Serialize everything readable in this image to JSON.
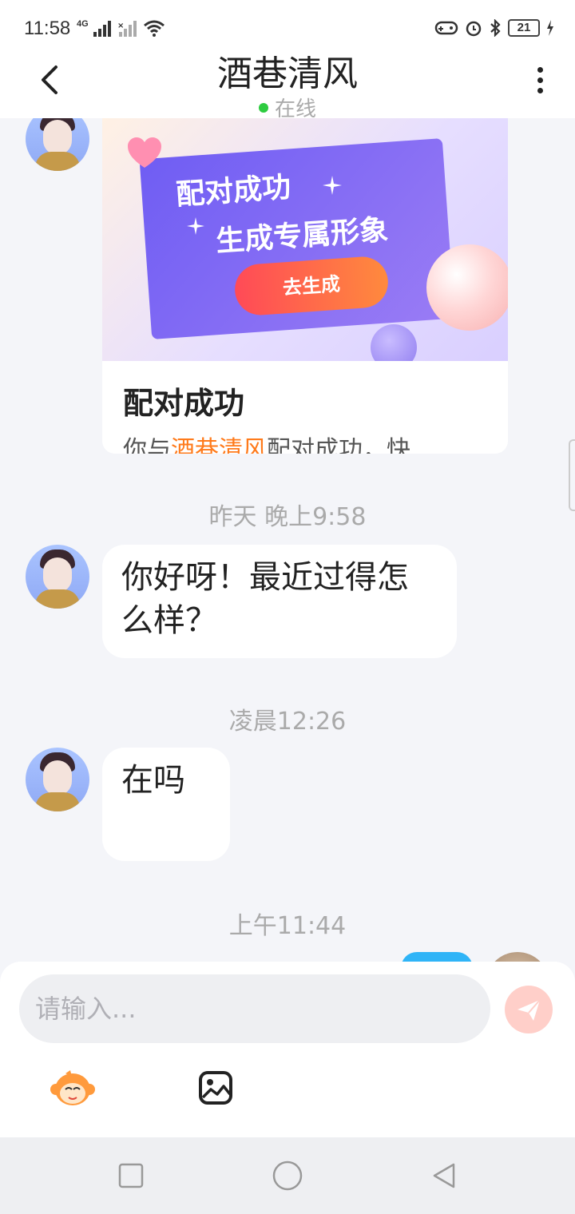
{
  "status_bar": {
    "time": "11:58",
    "network": "4G",
    "battery": "21"
  },
  "header": {
    "title": "酒巷清风",
    "online_status": "在线"
  },
  "card": {
    "banner_line1": "配对成功",
    "banner_line2": "生成专属形象",
    "banner_button": "去生成",
    "title": "配对成功",
    "desc_prefix": "你与",
    "desc_name": "酒巷清风",
    "desc_suffix": "配对成功，快"
  },
  "messages": [
    {
      "time": "昨天 晚上9:58",
      "text": "你好呀！最近过得怎么样？"
    },
    {
      "time": "凌晨12:26",
      "text": "在吗"
    },
    {
      "time": "上午11:44",
      "text": ""
    }
  ],
  "input": {
    "placeholder": "请输入..."
  }
}
